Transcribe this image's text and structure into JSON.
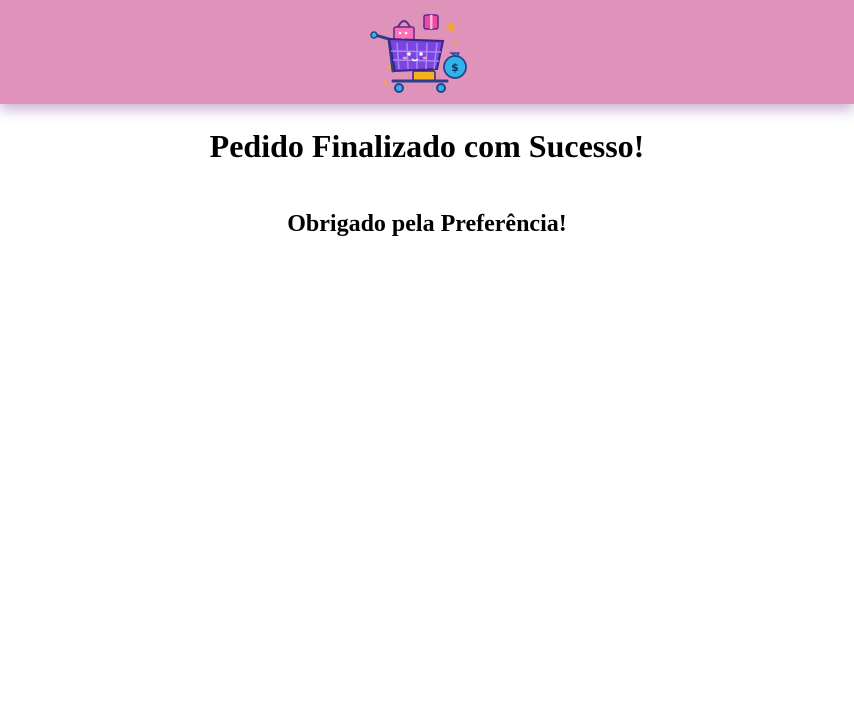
{
  "header": {
    "logo_icon": "shopping-cart-icon",
    "background_color": "#df93bb"
  },
  "main": {
    "title": "Pedido Finalizado com Sucesso!",
    "subtitle": "Obrigado pela Preferência!"
  }
}
